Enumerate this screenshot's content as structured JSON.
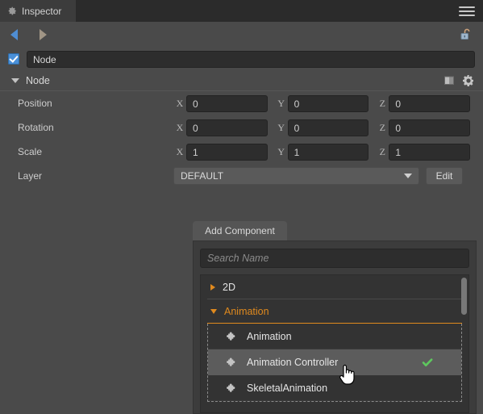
{
  "window": {
    "tab_label": "Inspector",
    "tab_icon": "gear-icon",
    "menu_icon": "hamburger-menu-icon"
  },
  "nav": {
    "back_icon": "arrow-left-icon",
    "forward_icon": "arrow-right-icon",
    "lock_icon": "unlock-padlock-icon"
  },
  "node": {
    "enabled": true,
    "name_value": "Node",
    "section_title": "Node",
    "help_icon": "book-icon",
    "settings_icon": "gear-icon",
    "properties": [
      {
        "label": "Position",
        "axes": [
          {
            "letter": "X",
            "value": "0"
          },
          {
            "letter": "Y",
            "value": "0"
          },
          {
            "letter": "Z",
            "value": "0"
          }
        ]
      },
      {
        "label": "Rotation",
        "axes": [
          {
            "letter": "X",
            "value": "0"
          },
          {
            "letter": "Y",
            "value": "0"
          },
          {
            "letter": "Z",
            "value": "0"
          }
        ]
      },
      {
        "label": "Scale",
        "axes": [
          {
            "letter": "X",
            "value": "1"
          },
          {
            "letter": "Y",
            "value": "1"
          },
          {
            "letter": "Z",
            "value": "1"
          }
        ]
      }
    ],
    "layer": {
      "label": "Layer",
      "selected": "DEFAULT",
      "edit_label": "Edit"
    }
  },
  "add_component": {
    "tab_label": "Add Component",
    "search_placeholder": "Search Name",
    "groups": [
      {
        "name": "2D",
        "expanded": false,
        "items": []
      },
      {
        "name": "Animation",
        "expanded": true,
        "items": [
          {
            "label": "Animation",
            "icon": "puzzle-piece-icon",
            "selected": false,
            "checked": false
          },
          {
            "label": "Animation Controller",
            "icon": "puzzle-piece-icon",
            "selected": true,
            "checked": true
          },
          {
            "label": "SkeletalAnimation",
            "icon": "puzzle-piece-icon",
            "selected": false,
            "checked": false
          }
        ]
      }
    ]
  },
  "colors": {
    "accent_orange": "#e08a1e",
    "check_green": "#5ec75e",
    "checkbox_blue": "#4a90d9",
    "panel_bg": "#4a4a4a",
    "popup_bg": "#3c3c3c"
  }
}
